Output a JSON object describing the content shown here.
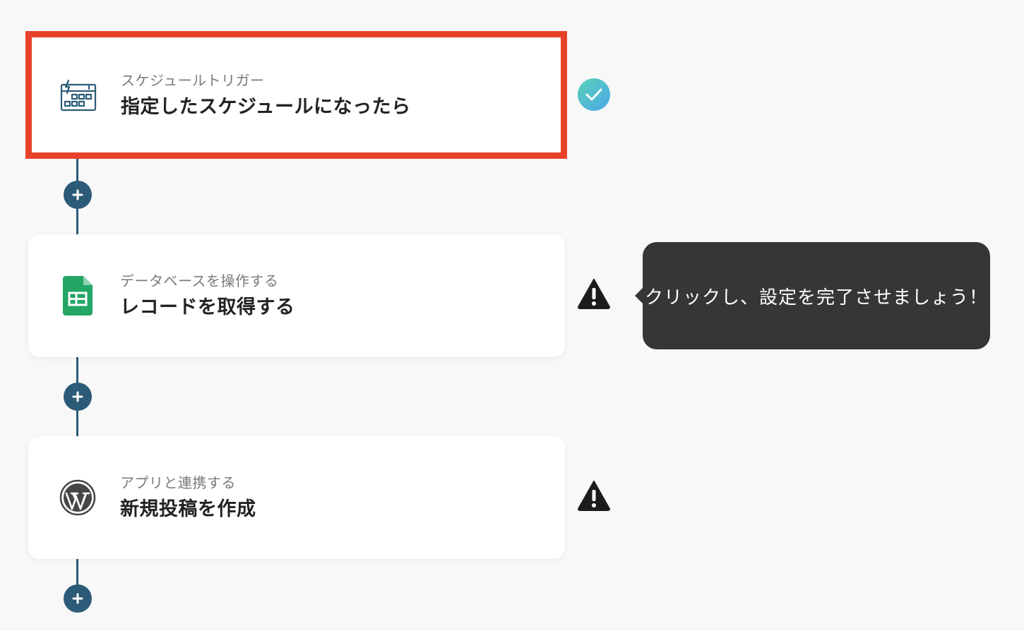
{
  "steps": [
    {
      "subtitle": "スケジュールトリガー",
      "title": "指定したスケジュールになったら",
      "icon": "schedule-trigger-icon",
      "status": "complete",
      "highlighted": true
    },
    {
      "subtitle": "データベースを操作する",
      "title": "レコードを取得する",
      "icon": "google-sheets-icon",
      "status": "warning"
    },
    {
      "subtitle": "アプリと連携する",
      "title": "新規投稿を作成",
      "icon": "wordpress-icon",
      "status": "warning"
    }
  ],
  "tooltip": {
    "text": "クリックし、設定を完了させましょう！"
  },
  "colors": {
    "connector": "#2c5b78",
    "highlight_border": "#e8412a",
    "check_gradient_start": "#5ad0b8",
    "check_gradient_end": "#4aa8e6",
    "tooltip_bg": "#363636",
    "sheets_green": "#23a566"
  }
}
